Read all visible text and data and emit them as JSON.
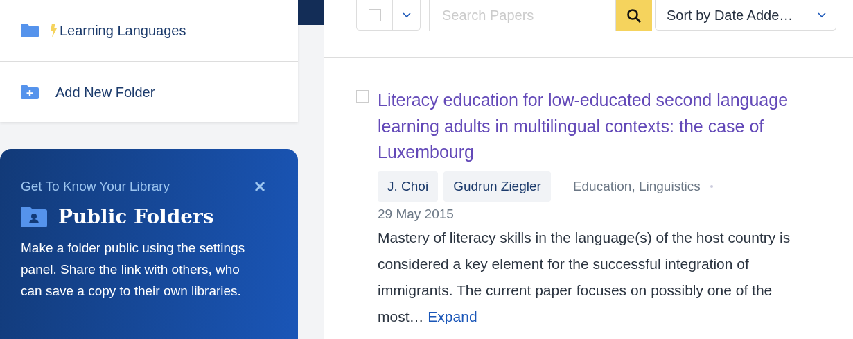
{
  "sidebar": {
    "folders": [
      {
        "name": "Learning Languages"
      }
    ],
    "add_folder": "Add New Folder"
  },
  "tip_card": {
    "eyebrow": "Get To Know Your Library",
    "title": "Public Folders",
    "body": "Make a folder public using the settings panel. Share the link with others, who can save a copy to their own libraries."
  },
  "toolbar": {
    "select_all": {
      "checked": false
    },
    "search": {
      "placeholder": "Search Papers"
    },
    "sort": "Sort by Date Adde…"
  },
  "papers": [
    {
      "checked": false,
      "title": "Literacy education for low-educated second language learning adults in multilingual contexts: the case of Luxembourg",
      "authors": [
        "J. Choi",
        "Gudrun Ziegler"
      ],
      "fields": "Education, Linguistics",
      "date": "29 May 2015",
      "abstract": "Mastery of literacy skills in the language(s) of the host country is considered a key element for the successful integration of immigrants. The current paper focuses on possibly one of the most…",
      "expand": "Expand"
    }
  ]
}
